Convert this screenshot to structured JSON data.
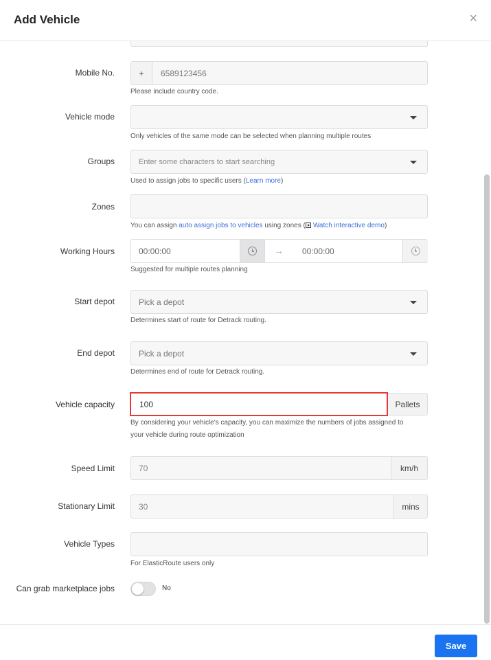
{
  "modal": {
    "title": "Add Vehicle",
    "close": "×"
  },
  "mobile": {
    "label": "Mobile No.",
    "prefix": "+",
    "value": "6589123456",
    "help": "Please include country code."
  },
  "vehicle_mode": {
    "label": "Vehicle mode",
    "help": "Only vehicles of the same mode can be selected when planning multiple routes"
  },
  "groups": {
    "label": "Groups",
    "placeholder": "Enter some characters to start searching",
    "help_pre": "Used to assign jobs to specific users (",
    "help_link": "Learn more",
    "help_post": ")"
  },
  "zones": {
    "label": "Zones",
    "help_pre": "You can assign ",
    "help_link1": "auto assign jobs to vehicles",
    "help_mid": " using zones (",
    "help_link2": "Watch interactive demo",
    "help_post": ")"
  },
  "working_hours": {
    "label": "Working Hours",
    "start": "00:00:00",
    "end": "00:00:00",
    "arrow": "→",
    "help": "Suggested for multiple routes planning"
  },
  "start_depot": {
    "label": "Start depot",
    "placeholder": "Pick a depot",
    "help": "Determines start of route for Detrack routing."
  },
  "end_depot": {
    "label": "End depot",
    "placeholder": "Pick a depot",
    "help": "Determines end of route for Detrack routing."
  },
  "capacity": {
    "label": "Vehicle capacity",
    "value": "100",
    "unit": "Pallets",
    "help_line1": "By considering your vehicle's capacity, you can maximize the numbers of jobs assigned to",
    "help_line2": "your vehicle during route optimization"
  },
  "speed": {
    "label": "Speed Limit",
    "value": "70",
    "unit": "km/h"
  },
  "stationary": {
    "label": "Stationary Limit",
    "value": "30",
    "unit": "mins"
  },
  "vehicle_types": {
    "label": "Vehicle Types",
    "help": "For ElasticRoute users only"
  },
  "marketplace": {
    "label": "Can grab marketplace jobs",
    "state": "No"
  },
  "footer": {
    "save": "Save"
  },
  "colors": {
    "primary": "#1a73f0",
    "link": "#3b6fd6",
    "highlight": "#e53935"
  }
}
